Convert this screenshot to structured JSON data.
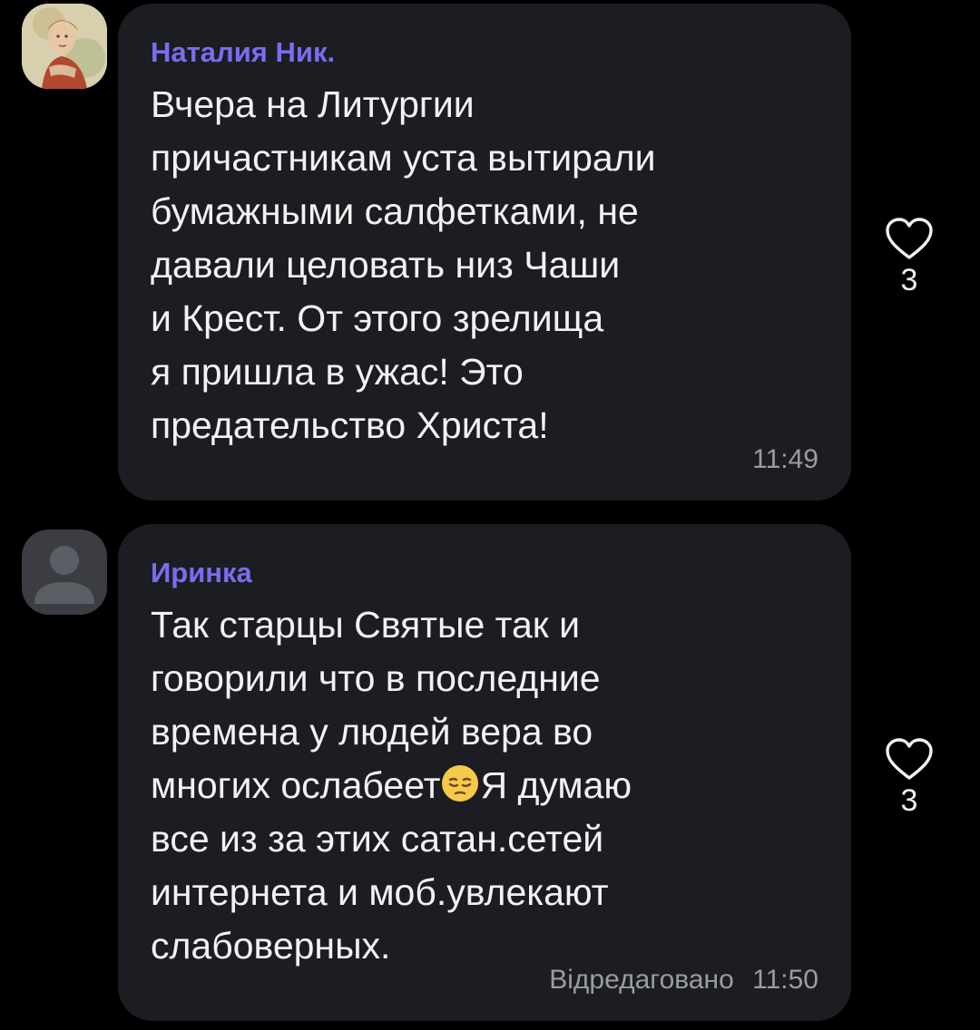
{
  "comments": [
    {
      "author": "Наталия Ник.",
      "avatar_icon": "painted-portrait-avatar",
      "text": "Вчера на Литургии\nпричастникам уста вытирали\nбумажными салфетками, не\nдавали целовать низ Чаши\nи Крест. От этого зрелища\nя пришла в ужас! Это\nпредательство Христа!",
      "edited_label": "",
      "time": "11:49",
      "likes": "3",
      "like_icon": "heart-outline-icon"
    },
    {
      "author": "Иринка",
      "avatar_icon": "default-user-avatar",
      "text_before_emoji": "Так старцы Святые так и\nговорили что в последние\nвремена у людей вера во\nмногих ослабеет",
      "emoji": "pensive-face-emoji",
      "text_after_emoji": "Я думаю\nвсе из за этих сатан.сетей\nинтернета и моб.увлекают\nслабоверных.",
      "edited_label": "Відредаговано",
      "time": "11:50",
      "likes": "3",
      "like_icon": "heart-outline-icon"
    }
  ],
  "colors": {
    "background": "#000000",
    "bubble": "#1c1d22",
    "author": "#7b6cf0",
    "text": "#f2f2f2",
    "meta": "#9a9ca3"
  }
}
